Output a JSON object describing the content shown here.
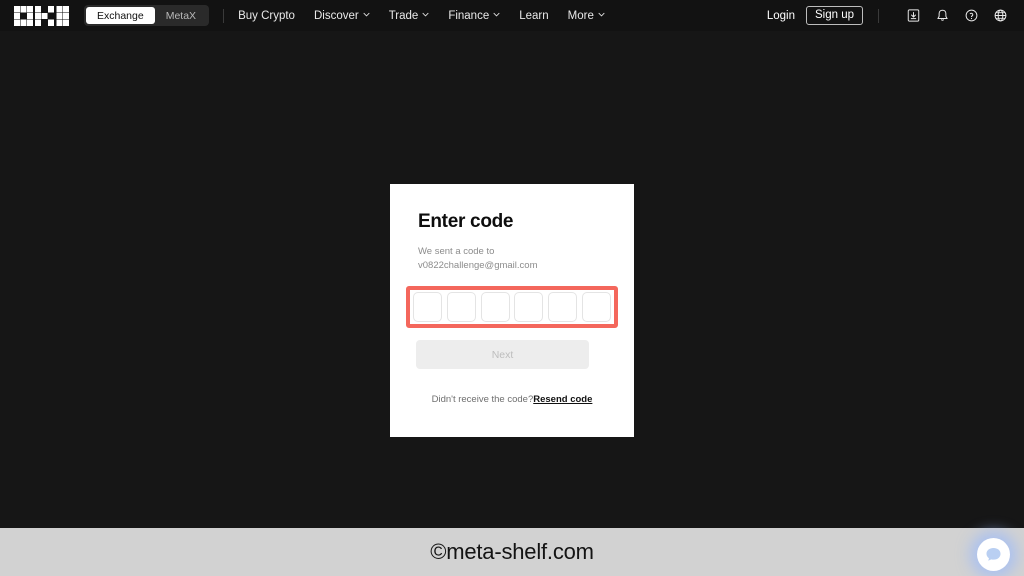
{
  "header": {
    "logo_name": "okx-logo",
    "segments": [
      {
        "label": "Exchange",
        "active": true
      },
      {
        "label": "MetaX",
        "active": false
      }
    ],
    "nav": [
      {
        "label": "Buy Crypto",
        "caret": false
      },
      {
        "label": "Discover",
        "caret": true
      },
      {
        "label": "Trade",
        "caret": true
      },
      {
        "label": "Finance",
        "caret": true
      },
      {
        "label": "Learn",
        "caret": false
      },
      {
        "label": "More",
        "caret": true
      }
    ],
    "login_label": "Login",
    "signup_label": "Sign up",
    "icons": [
      {
        "name": "download-icon"
      },
      {
        "name": "bell-icon"
      },
      {
        "name": "help-circle-icon"
      },
      {
        "name": "globe-icon"
      }
    ]
  },
  "modal": {
    "title": "Enter code",
    "subtitle_line1": "We sent a code to",
    "subtitle_line2": "v0822challenge@gmail.com",
    "code_boxes": [
      "",
      "",
      "",
      "",
      "",
      ""
    ],
    "code_box_count": 6,
    "highlight_color": "#f4675c",
    "next_label": "Next",
    "next_disabled": true,
    "resend_prompt": "Didn't receive the code?",
    "resend_link": "Resend code"
  },
  "footer": {
    "text": "©meta-shelf.com",
    "chat_icon": "chat-bubble-icon"
  },
  "colors": {
    "page_background": "#161616",
    "header_background": "#121212",
    "modal_background": "#ffffff",
    "accent_red": "#f4675c",
    "footer_background": "#d2d2d2"
  }
}
